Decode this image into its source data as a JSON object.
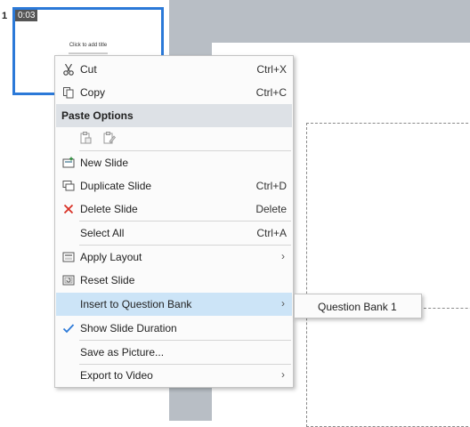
{
  "thumbnail": {
    "slide_number": "1",
    "duration": "0:03",
    "title_placeholder": "Click to add title"
  },
  "context_menu": {
    "items": [
      {
        "label": "Cut",
        "shortcut": "Ctrl+X",
        "icon": "scissors-icon"
      },
      {
        "label": "Copy",
        "shortcut": "Ctrl+C",
        "icon": "copy-icon"
      },
      {
        "label": "New Slide",
        "shortcut": "",
        "icon": "new-slide-icon"
      },
      {
        "label": "Duplicate Slide",
        "shortcut": "Ctrl+D",
        "icon": "duplicate-slide-icon"
      },
      {
        "label": "Delete Slide",
        "shortcut": "Delete",
        "icon": "delete-x-icon"
      },
      {
        "label": "Select All",
        "shortcut": "Ctrl+A",
        "icon": ""
      },
      {
        "label": "Apply Layout",
        "shortcut": "",
        "icon": "layout-icon",
        "submenu": true
      },
      {
        "label": "Reset Slide",
        "shortcut": "",
        "icon": "reset-slide-icon"
      },
      {
        "label": "Insert to Question Bank",
        "shortcut": "",
        "icon": "",
        "submenu": true,
        "highlighted": true
      },
      {
        "label": "Show Slide Duration",
        "shortcut": "",
        "icon": "checkmark-icon",
        "checked": true
      },
      {
        "label": "Save as Picture...",
        "shortcut": "",
        "icon": ""
      },
      {
        "label": "Export to Video",
        "shortcut": "",
        "icon": "",
        "submenu": true
      }
    ],
    "paste_options_header": "Paste Options",
    "submenu_arrow": "›"
  },
  "submenu": {
    "items": [
      {
        "label": "Question Bank 1"
      }
    ]
  },
  "colors": {
    "accent": "#2b79d8",
    "highlight": "#cce4f7",
    "delete_red": "#d93025",
    "check_blue": "#2b79d8"
  }
}
